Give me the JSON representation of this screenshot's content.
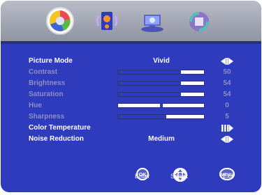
{
  "tabs": [
    {
      "name": "picture"
    },
    {
      "name": "sound"
    },
    {
      "name": "setup"
    },
    {
      "name": "tools"
    }
  ],
  "menu": {
    "picture_mode": {
      "label": "Picture Mode",
      "value": "Vivid"
    },
    "contrast": {
      "label": "Contrast",
      "value": 50
    },
    "brightness": {
      "label": "Brightness",
      "value": 54
    },
    "saturation": {
      "label": "Saturation",
      "value": 54
    },
    "hue": {
      "label": "Hue",
      "value": 0
    },
    "sharpness": {
      "label": "Sharpness",
      "value": 5
    },
    "color_temperature": {
      "label": "Color Temperature"
    },
    "noise_reduction": {
      "label": "Noise Reduction",
      "value": "Medium"
    }
  },
  "footer": {
    "ok_label": "OK",
    "enter": "Enter",
    "select": "Select",
    "menu_label": "MENU",
    "exit": "Exit"
  },
  "colors": {
    "osd_background": "#2f3bbd",
    "header_background": "#a8adb9",
    "active_text": "#ffffff",
    "dim_text": "#8b8fc9",
    "bar_fill": "#2f3bbd"
  }
}
